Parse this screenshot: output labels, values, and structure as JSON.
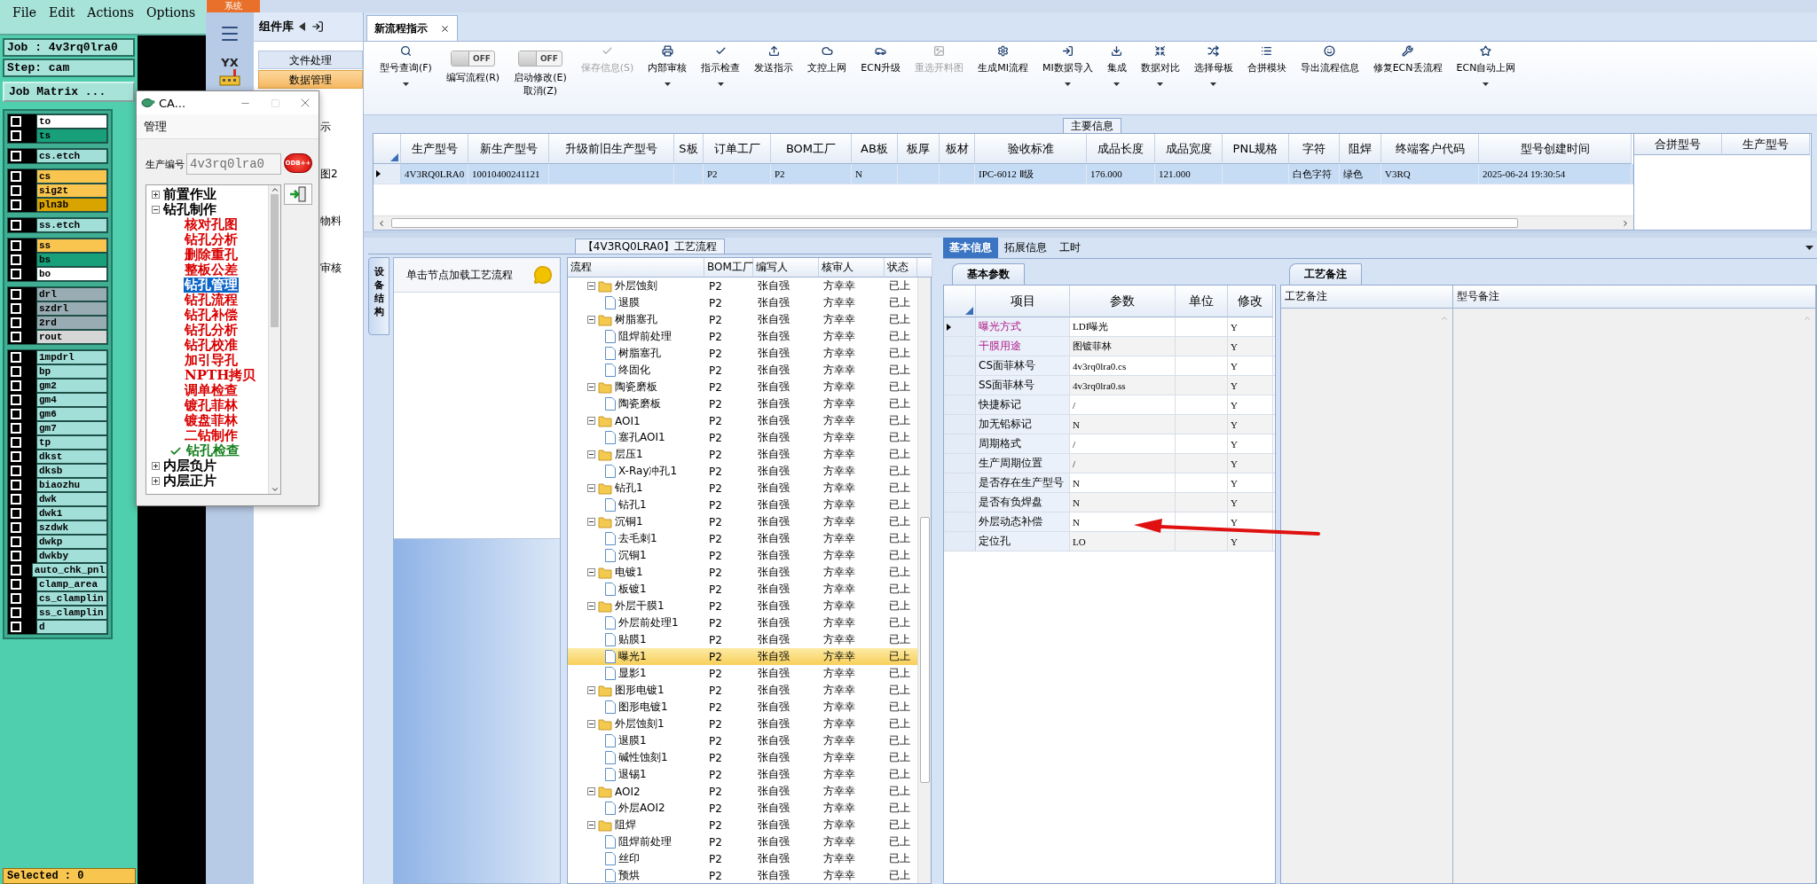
{
  "cam": {
    "menu": [
      "File",
      "Edit",
      "Actions",
      "Options"
    ],
    "job": "Job : 4v3rq0lra0",
    "step": "Step: cam",
    "matrix_button": "Job Matrix ...",
    "layer_groups": [
      {
        "layers": [
          {
            "name": "to",
            "color": "#ffffff",
            "checked": false
          },
          {
            "name": "ts",
            "color": "#17a07a",
            "checked": false
          }
        ]
      },
      {
        "layers": [
          {
            "name": "cs.etch",
            "color": "#a3dfd9",
            "checked": false
          }
        ]
      },
      {
        "layers": [
          {
            "name": "cs",
            "color": "#f9c54f",
            "checked": false
          },
          {
            "name": "sig2t",
            "color": "#f9c54f",
            "checked": false
          },
          {
            "name": "pln3b",
            "color": "#d9a300",
            "checked": false
          }
        ]
      },
      {
        "layers": [
          {
            "name": "ss.etch",
            "color": "#a3dfd9",
            "checked": false
          }
        ]
      },
      {
        "layers": [
          {
            "name": "ss",
            "color": "#f9c54f",
            "checked": false
          },
          {
            "name": "bs",
            "color": "#17a07a",
            "checked": false
          },
          {
            "name": "bo",
            "color": "#ffffff",
            "checked": false
          }
        ]
      },
      {
        "layers": [
          {
            "name": "drl",
            "color": "#99acb3",
            "checked": false
          },
          {
            "name": "szdrl",
            "color": "#99acb3",
            "checked": false
          },
          {
            "name": "2rd",
            "color": "#99acb3",
            "checked": false
          },
          {
            "name": "rout",
            "color": "#d6d6d6",
            "checked": false
          }
        ]
      },
      {
        "layers": [
          {
            "name": "1mpdrl",
            "color": "#a3dfd9",
            "checked": false
          },
          {
            "name": "bp",
            "color": "#a3dfd9",
            "checked": false
          },
          {
            "name": "gm2",
            "color": "#a3dfd9",
            "checked": false
          },
          {
            "name": "gm4",
            "color": "#a3dfd9",
            "checked": false
          },
          {
            "name": "gm6",
            "color": "#a3dfd9",
            "checked": false
          },
          {
            "name": "gm7",
            "color": "#a3dfd9",
            "checked": false
          },
          {
            "name": "tp",
            "color": "#a3dfd9",
            "checked": false
          },
          {
            "name": "dkst",
            "color": "#a3dfd9",
            "checked": false
          },
          {
            "name": "dksb",
            "color": "#a3dfd9",
            "checked": false
          },
          {
            "name": "biaozhu",
            "color": "#a3dfd9",
            "checked": false
          },
          {
            "name": "dwk",
            "color": "#a3dfd9",
            "checked": false
          },
          {
            "name": "dwk1",
            "color": "#a3dfd9",
            "checked": false
          },
          {
            "name": "szdwk",
            "color": "#a3dfd9",
            "checked": false
          },
          {
            "name": "dwkp",
            "color": "#a3dfd9",
            "checked": false
          },
          {
            "name": "dwkby",
            "color": "#a3dfd9",
            "checked": false
          },
          {
            "name": "auto_chk_pnl",
            "color": "#a3dfd9",
            "checked": false
          },
          {
            "name": "clamp_area",
            "color": "#a3dfd9",
            "checked": false
          },
          {
            "name": "cs_clamplin",
            "color": "#a3dfd9",
            "checked": false
          },
          {
            "name": "ss_clamplin",
            "color": "#a3dfd9",
            "checked": false
          },
          {
            "name": "d",
            "color": "#a3dfd9",
            "checked": false
          }
        ]
      }
    ],
    "status": "Selected : 0"
  },
  "cam_window": {
    "title": "CA...",
    "menu": [
      "管理"
    ],
    "field_label": "生产编号",
    "field_value": "4v3rq0lra0",
    "odb_button": "ODB++",
    "tree": [
      {
        "label": "前置作业",
        "expanded": false
      },
      {
        "label": "钻孔制作",
        "expanded": true,
        "children": [
          {
            "label": "核对孔图",
            "selected": false,
            "checked": false
          },
          {
            "label": "钻孔分析",
            "selected": false,
            "checked": false
          },
          {
            "label": "删除重孔",
            "selected": false,
            "checked": false
          },
          {
            "label": "整板公差",
            "selected": false,
            "checked": false
          },
          {
            "label": "钻孔管理",
            "selected": true,
            "checked": false
          },
          {
            "label": "钻孔流程",
            "selected": false,
            "checked": false
          },
          {
            "label": "钻孔补偿",
            "selected": false,
            "checked": false
          },
          {
            "label": "钻孔分析",
            "selected": false,
            "checked": false
          },
          {
            "label": "钻孔校准",
            "selected": false,
            "checked": false
          },
          {
            "label": "加引导孔",
            "selected": false,
            "checked": false
          },
          {
            "label": "NPTH拷贝",
            "selected": false,
            "checked": false
          },
          {
            "label": "调单检查",
            "selected": false,
            "checked": false
          },
          {
            "label": "镀孔菲林",
            "selected": false,
            "checked": false
          },
          {
            "label": "镀盘菲林",
            "selected": false,
            "checked": false
          },
          {
            "label": "二钻制作",
            "selected": false,
            "checked": false
          },
          {
            "label": "钻孔检查",
            "selected": false,
            "checked": true
          }
        ]
      },
      {
        "label": "内层负片",
        "expanded": false
      },
      {
        "label": "内层正片",
        "expanded": false
      }
    ]
  },
  "app": {
    "system_tab": "系统",
    "logo_text": "YX",
    "component_panel": {
      "title": "组件库",
      "items": [
        {
          "label": "文件处理",
          "selected": false
        },
        {
          "label": "数据管理",
          "selected": true
        }
      ],
      "covered_items": [
        "示",
        "图2",
        "物料",
        "审核"
      ]
    }
  },
  "document_tab": {
    "label": "新流程指示"
  },
  "toolbar": [
    {
      "kind": "button",
      "label": "型号查询(F)",
      "dropdown": true,
      "disabled": false
    },
    {
      "kind": "toggle",
      "label": "编写流程(R)",
      "switch_text": "OFF",
      "on": false
    },
    {
      "kind": "toggle",
      "label": "启动修改(E)",
      "sublabel": "取消(Z)",
      "switch_text": "OFF",
      "on": false
    },
    {
      "kind": "button",
      "label": "保存信息(S)",
      "dropdown": false,
      "disabled": true
    },
    {
      "kind": "button",
      "label": "内部审核",
      "dropdown": true,
      "disabled": false
    },
    {
      "kind": "button",
      "label": "指示检查",
      "dropdown": true,
      "disabled": false
    },
    {
      "kind": "button",
      "label": "发送指示",
      "dropdown": false,
      "disabled": false
    },
    {
      "kind": "button",
      "label": "文控上网",
      "dropdown": false,
      "disabled": false
    },
    {
      "kind": "button",
      "label": "ECN升级",
      "dropdown": false,
      "disabled": false
    },
    {
      "kind": "button",
      "label": "重选开料图",
      "dropdown": false,
      "disabled": true
    },
    {
      "kind": "button",
      "label": "生成MI流程",
      "dropdown": false,
      "disabled": false
    },
    {
      "kind": "button",
      "label": "MI数据导入",
      "dropdown": true,
      "disabled": false
    },
    {
      "kind": "button",
      "label": "集成",
      "dropdown": true,
      "disabled": false
    },
    {
      "kind": "button",
      "label": "数据对比",
      "dropdown": true,
      "disabled": false
    },
    {
      "kind": "button",
      "label": "选择母板",
      "dropdown": true,
      "disabled": false
    },
    {
      "kind": "button",
      "label": "合拼模块",
      "dropdown": false,
      "disabled": false
    },
    {
      "kind": "button",
      "label": "导出流程信息",
      "dropdown": false,
      "disabled": false
    },
    {
      "kind": "button",
      "label": "修复ECN丢流程",
      "dropdown": false,
      "disabled": false
    },
    {
      "kind": "button",
      "label": "ECN自动上网",
      "dropdown": true,
      "disabled": false
    }
  ],
  "main_info": {
    "legend": "主要信息",
    "columns": [
      "生产型号",
      "新生产型号",
      "升级前旧生产型号",
      "S板",
      "订单工厂",
      "BOM工厂",
      "AB板",
      "板厚",
      "板材",
      "验收标准",
      "成品长度",
      "成品宽度",
      "PNL规格",
      "字符",
      "阻焊",
      "终端客户代码",
      "型号创建时间"
    ],
    "rows": [
      {
        "selected": true,
        "cells": [
          "4V3RQ0LRA0",
          "10010400241121",
          null,
          null,
          "P2",
          "P2",
          "N",
          null,
          null,
          "IPC-6012 Ⅱ级",
          "176.000",
          "121.000",
          null,
          "白色字符",
          "绿色",
          "V3RQ",
          "2025-06-24 19:30:54"
        ]
      }
    ],
    "side_columns": [
      "合拼型号",
      "生产型号"
    ]
  },
  "process": {
    "legend": "【4V3RQ0LRA0】工艺流程",
    "side_tab": "设备结构",
    "hint": "单击节点加载工艺流程",
    "columns": [
      "流程",
      "BOM工厂",
      "编写人",
      "核审人",
      "状态"
    ],
    "nodes": [
      {
        "name": "外层蚀刻",
        "bom": "P2",
        "writer": "张自强",
        "reviewer": "方幸幸",
        "status": "已上",
        "selected": false,
        "expanded": true,
        "children": [
          {
            "name": "退膜",
            "bom": "P2",
            "writer": "张自强",
            "reviewer": "方幸幸",
            "status": "已上",
            "selected": false
          }
        ]
      },
      {
        "name": "树脂塞孔",
        "bom": "P2",
        "writer": "张自强",
        "reviewer": "方幸幸",
        "status": "已上",
        "selected": false,
        "expanded": true,
        "children": [
          {
            "name": "阻焊前处理",
            "bom": "P2",
            "writer": "张自强",
            "reviewer": "方幸幸",
            "status": "已上",
            "selected": false
          },
          {
            "name": "树脂塞孔",
            "bom": "P2",
            "writer": "张自强",
            "reviewer": "方幸幸",
            "status": "已上",
            "selected": false
          },
          {
            "name": "终固化",
            "bom": "P2",
            "writer": "张自强",
            "reviewer": "方幸幸",
            "status": "已上",
            "selected": false
          }
        ]
      },
      {
        "name": "陶瓷磨板",
        "bom": "P2",
        "writer": "张自强",
        "reviewer": "方幸幸",
        "status": "已上",
        "selected": false,
        "expanded": true,
        "children": [
          {
            "name": "陶瓷磨板",
            "bom": "P2",
            "writer": "张自强",
            "reviewer": "方幸幸",
            "status": "已上",
            "selected": false
          }
        ]
      },
      {
        "name": "AOI1",
        "bom": "P2",
        "writer": "张自强",
        "reviewer": "方幸幸",
        "status": "已上",
        "selected": false,
        "expanded": true,
        "children": [
          {
            "name": "塞孔AOI1",
            "bom": "P2",
            "writer": "张自强",
            "reviewer": "方幸幸",
            "status": "已上",
            "selected": false
          }
        ]
      },
      {
        "name": "层压1",
        "bom": "P2",
        "writer": "张自强",
        "reviewer": "方幸幸",
        "status": "已上",
        "selected": false,
        "expanded": true,
        "children": [
          {
            "name": "X-Ray冲孔1",
            "bom": "P2",
            "writer": "张自强",
            "reviewer": "方幸幸",
            "status": "已上",
            "selected": false
          }
        ]
      },
      {
        "name": "钻孔1",
        "bom": "P2",
        "writer": "张自强",
        "reviewer": "方幸幸",
        "status": "已上",
        "selected": false,
        "expanded": true,
        "children": [
          {
            "name": "钻孔1",
            "bom": "P2",
            "writer": "张自强",
            "reviewer": "方幸幸",
            "status": "已上",
            "selected": false
          }
        ]
      },
      {
        "name": "沉铜1",
        "bom": "P2",
        "writer": "张自强",
        "reviewer": "方幸幸",
        "status": "已上",
        "selected": false,
        "expanded": true,
        "children": [
          {
            "name": "去毛刺1",
            "bom": "P2",
            "writer": "张自强",
            "reviewer": "方幸幸",
            "status": "已上",
            "selected": false
          },
          {
            "name": "沉铜1",
            "bom": "P2",
            "writer": "张自强",
            "reviewer": "方幸幸",
            "status": "已上",
            "selected": false
          }
        ]
      },
      {
        "name": "电镀1",
        "bom": "P2",
        "writer": "张自强",
        "reviewer": "方幸幸",
        "status": "已上",
        "selected": false,
        "expanded": true,
        "children": [
          {
            "name": "板镀1",
            "bom": "P2",
            "writer": "张自强",
            "reviewer": "方幸幸",
            "status": "已上",
            "selected": false
          }
        ]
      },
      {
        "name": "外层干膜1",
        "bom": "P2",
        "writer": "张自强",
        "reviewer": "方幸幸",
        "status": "已上",
        "selected": false,
        "expanded": true,
        "children": [
          {
            "name": "外层前处理1",
            "bom": "P2",
            "writer": "张自强",
            "reviewer": "方幸幸",
            "status": "已上",
            "selected": false
          },
          {
            "name": "贴膜1",
            "bom": "P2",
            "writer": "张自强",
            "reviewer": "方幸幸",
            "status": "已上",
            "selected": false
          },
          {
            "name": "曝光1",
            "bom": "P2",
            "writer": "张自强",
            "reviewer": "方幸幸",
            "status": "已上",
            "selected": true
          },
          {
            "name": "显影1",
            "bom": "P2",
            "writer": "张自强",
            "reviewer": "方幸幸",
            "status": "已上",
            "selected": false
          }
        ]
      },
      {
        "name": "图形电镀1",
        "bom": "P2",
        "writer": "张自强",
        "reviewer": "方幸幸",
        "status": "已上",
        "selected": false,
        "expanded": true,
        "children": [
          {
            "name": "图形电镀1",
            "bom": "P2",
            "writer": "张自强",
            "reviewer": "方幸幸",
            "status": "已上",
            "selected": false
          }
        ]
      },
      {
        "name": "外层蚀刻1",
        "bom": "P2",
        "writer": "张自强",
        "reviewer": "方幸幸",
        "status": "已上",
        "selected": false,
        "expanded": true,
        "children": [
          {
            "name": "退膜1",
            "bom": "P2",
            "writer": "张自强",
            "reviewer": "方幸幸",
            "status": "已上",
            "selected": false
          },
          {
            "name": "碱性蚀刻1",
            "bom": "P2",
            "writer": "张自强",
            "reviewer": "方幸幸",
            "status": "已上",
            "selected": false
          },
          {
            "name": "退锡1",
            "bom": "P2",
            "writer": "张自强",
            "reviewer": "方幸幸",
            "status": "已上",
            "selected": false
          }
        ]
      },
      {
        "name": "AOI2",
        "bom": "P2",
        "writer": "张自强",
        "reviewer": "方幸幸",
        "status": "已上",
        "selected": false,
        "expanded": true,
        "children": [
          {
            "name": "外层AOI2",
            "bom": "P2",
            "writer": "张自强",
            "reviewer": "方幸幸",
            "status": "已上",
            "selected": false
          }
        ]
      },
      {
        "name": "阻焊",
        "bom": "P2",
        "writer": "张自强",
        "reviewer": "方幸幸",
        "status": "已上",
        "selected": false,
        "expanded": true,
        "children": [
          {
            "name": "阻焊前处理",
            "bom": "P2",
            "writer": "张自强",
            "reviewer": "方幸幸",
            "status": "已上",
            "selected": false
          },
          {
            "name": "丝印",
            "bom": "P2",
            "writer": "张自强",
            "reviewer": "方幸幸",
            "status": "已上",
            "selected": false
          },
          {
            "name": "预烘",
            "bom": "P2",
            "writer": "张自强",
            "reviewer": "方幸幸",
            "status": "已上",
            "selected": false
          }
        ]
      }
    ]
  },
  "detail": {
    "tabs": [
      {
        "label": "基本信息",
        "selected": true
      },
      {
        "label": "拓展信息",
        "selected": false
      },
      {
        "label": "工时",
        "selected": false
      }
    ],
    "params": {
      "tab": "基本参数",
      "columns": [
        "项目",
        "参数",
        "单位",
        "修改"
      ],
      "rows": [
        {
          "item": "曝光方式",
          "value": "LDI曝光",
          "modify": "Y",
          "highlight": true,
          "selected": true
        },
        {
          "item": "干膜用途",
          "value": "图镀菲林",
          "modify": "Y",
          "highlight": true,
          "selected": false
        },
        {
          "item": "CS面菲林号",
          "value": "4v3rq0lra0.cs",
          "modify": "Y",
          "highlight": false,
          "selected": false
        },
        {
          "item": "SS面菲林号",
          "value": "4v3rq0lra0.ss",
          "modify": "Y",
          "highlight": false,
          "selected": false
        },
        {
          "item": "快捷标记",
          "value": "/",
          "modify": "Y",
          "highlight": false,
          "selected": false
        },
        {
          "item": "加无铅标记",
          "value": "N",
          "modify": "Y",
          "highlight": false,
          "selected": false
        },
        {
          "item": "周期格式",
          "value": "/",
          "modify": "Y",
          "highlight": false,
          "selected": false
        },
        {
          "item": "生产周期位置",
          "value": "/",
          "modify": "Y",
          "highlight": false,
          "selected": false
        },
        {
          "item": "是否存在生产型号",
          "value": "N",
          "modify": "Y",
          "highlight": false,
          "selected": false
        },
        {
          "item": "是否有负焊盘",
          "value": "N",
          "modify": "Y",
          "highlight": false,
          "selected": false
        },
        {
          "item": "外层动态补偿",
          "value": "N",
          "modify": "Y",
          "highlight": false,
          "selected": false
        },
        {
          "item": "定位孔",
          "value": "LO",
          "modify": "Y",
          "highlight": false,
          "selected": false
        }
      ]
    },
    "notes": {
      "tab": "工艺备注",
      "columns": [
        "工艺备注",
        "型号备注"
      ]
    }
  }
}
